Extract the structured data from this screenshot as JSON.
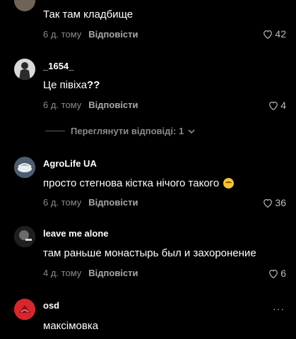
{
  "comments": [
    {
      "username": "",
      "text": "Так там кладбище",
      "time": "6 д. тому",
      "reply_label": "Відповісти",
      "likes": "42"
    },
    {
      "username": "_1654_",
      "text": "Це півіха",
      "text_suffix": "??",
      "time": "6 д. тому",
      "reply_label": "Відповісти",
      "likes": "4"
    },
    {
      "username": "AgroLife UA",
      "text": "просто стегнова кістка нічого такого",
      "emoji": "grinning-sweat-emoji",
      "time": "6 д. тому",
      "reply_label": "Відповісти",
      "likes": "36"
    },
    {
      "username": "leave me alone",
      "text": "там раньше монастырь был и захоронение",
      "time": "4 д. тому",
      "reply_label": "Відповісти",
      "likes": "6"
    },
    {
      "username": "osd",
      "text": "максімовка",
      "more": "···"
    }
  ],
  "view_replies_label": "Переглянути відповіді: 1",
  "colors": {
    "background": "#000000",
    "text": "#ffffff",
    "meta": "#8a8a8a",
    "osd_avatar": "#d8262e"
  }
}
